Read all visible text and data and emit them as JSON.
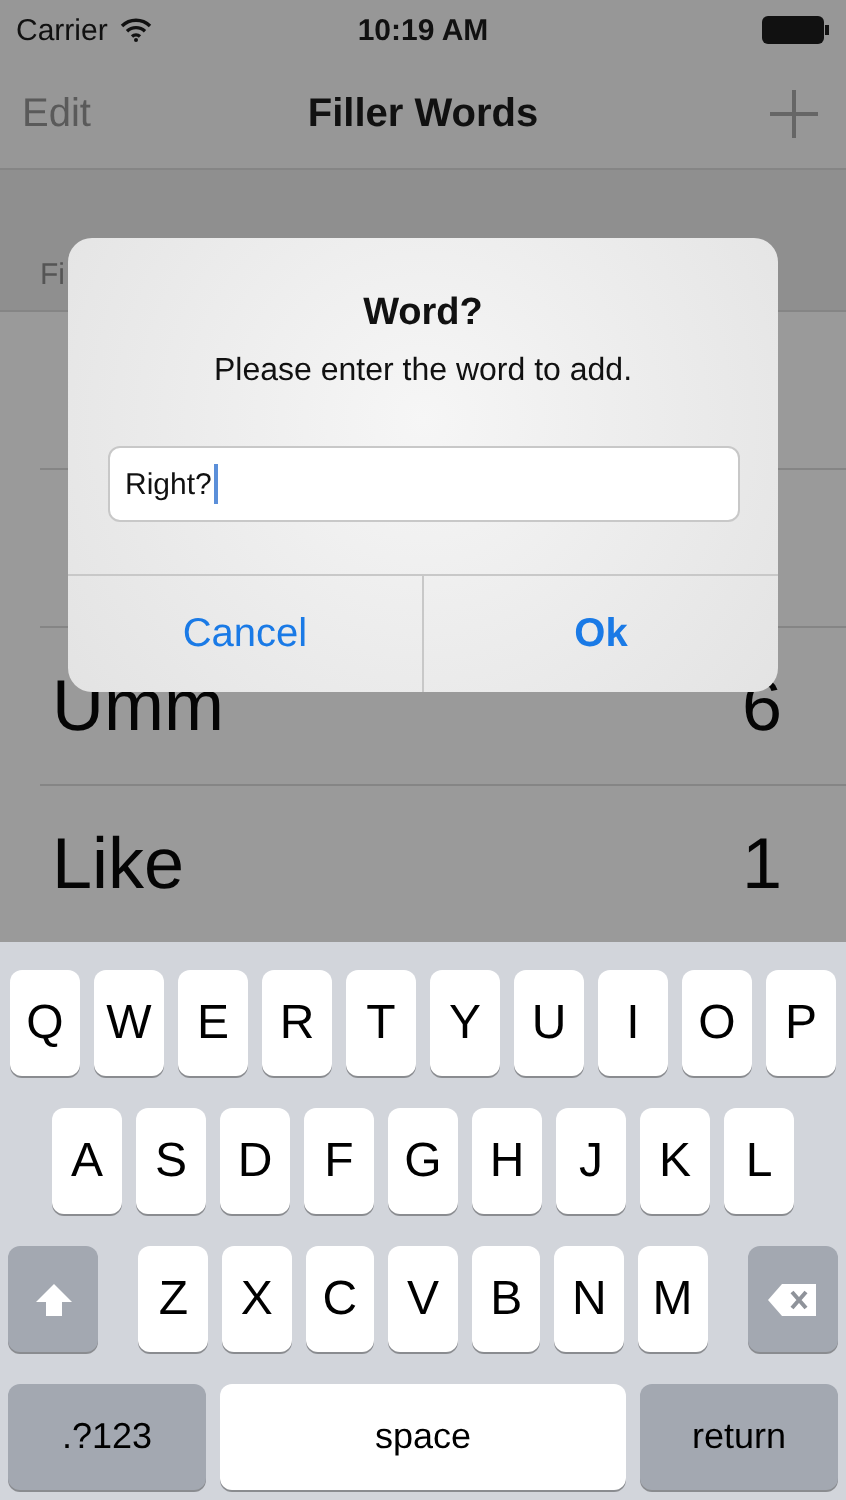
{
  "status_bar": {
    "carrier": "Carrier",
    "time": "10:19 AM"
  },
  "nav": {
    "left": "Edit",
    "title": "Filler Words"
  },
  "section_header": "Fi",
  "rows": [
    {
      "word": "Umm",
      "count": "6"
    },
    {
      "word": "Like",
      "count": "1"
    }
  ],
  "dialog": {
    "title": "Word?",
    "message": "Please enter the word to add.",
    "value": "Right?",
    "buttons": [
      {
        "label": "Cancel",
        "bold": false
      },
      {
        "label": "Ok",
        "bold": true
      }
    ]
  },
  "keyboard": [
    [
      {
        "kind": "letter",
        "label": "Q"
      },
      {
        "kind": "letter",
        "label": "W"
      },
      {
        "kind": "letter",
        "label": "E"
      },
      {
        "kind": "letter",
        "label": "R"
      },
      {
        "kind": "letter",
        "label": "T"
      },
      {
        "kind": "letter",
        "label": "Y"
      },
      {
        "kind": "letter",
        "label": "U"
      },
      {
        "kind": "letter",
        "label": "I"
      },
      {
        "kind": "letter",
        "label": "O"
      },
      {
        "kind": "letter",
        "label": "P"
      }
    ],
    [
      {
        "kind": "letter",
        "label": "A"
      },
      {
        "kind": "letter",
        "label": "S"
      },
      {
        "kind": "letter",
        "label": "D"
      },
      {
        "kind": "letter",
        "label": "F"
      },
      {
        "kind": "letter",
        "label": "G"
      },
      {
        "kind": "letter",
        "label": "H"
      },
      {
        "kind": "letter",
        "label": "J"
      },
      {
        "kind": "letter",
        "label": "K"
      },
      {
        "kind": "letter",
        "label": "L"
      }
    ],
    [
      {
        "kind": "shift"
      },
      {
        "kind": "letter",
        "label": "Z"
      },
      {
        "kind": "letter",
        "label": "X"
      },
      {
        "kind": "letter",
        "label": "C"
      },
      {
        "kind": "letter",
        "label": "V"
      },
      {
        "kind": "letter",
        "label": "B"
      },
      {
        "kind": "letter",
        "label": "N"
      },
      {
        "kind": "letter",
        "label": "M"
      },
      {
        "kind": "delete"
      }
    ],
    [
      {
        "kind": "mode",
        "label": ".?123"
      },
      {
        "kind": "space",
        "label": "space"
      },
      {
        "kind": "return",
        "label": "return"
      }
    ]
  ]
}
